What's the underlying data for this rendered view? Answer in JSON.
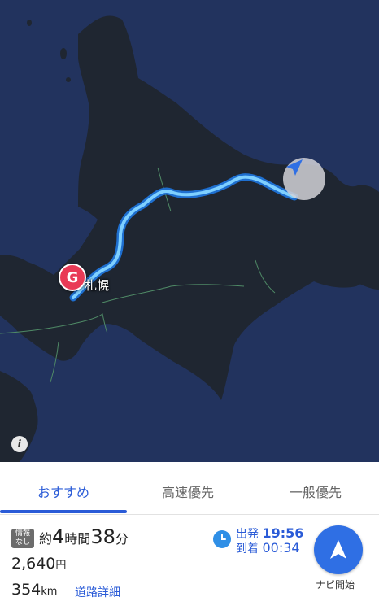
{
  "map": {
    "city_label": "札幌",
    "goal_marker": "G",
    "info_icon_glyph": "i",
    "colors": {
      "sea": "#22335e",
      "land": "#1f2631",
      "route": "#59b8ff",
      "goal": "#e93a56"
    }
  },
  "tabs": [
    {
      "label": "おすすめ",
      "active": true
    },
    {
      "label": "高速優先",
      "active": false
    },
    {
      "label": "一般優先",
      "active": false
    }
  ],
  "route": {
    "info_badge": [
      "情報",
      "なし"
    ],
    "time_prefix": "約",
    "hours": "4",
    "hours_unit": "時間",
    "minutes": "38",
    "minutes_unit": "分",
    "toll_value": "2,640",
    "toll_unit": "円",
    "distance_value": "354",
    "distance_unit": "km",
    "detail_link": "道路詳細"
  },
  "schedule": {
    "departure_label": "出発",
    "departure_time": "19:56",
    "arrival_label": "到着",
    "arrival_time": "00:34"
  },
  "navi_button": {
    "label": "ナビ開始"
  }
}
